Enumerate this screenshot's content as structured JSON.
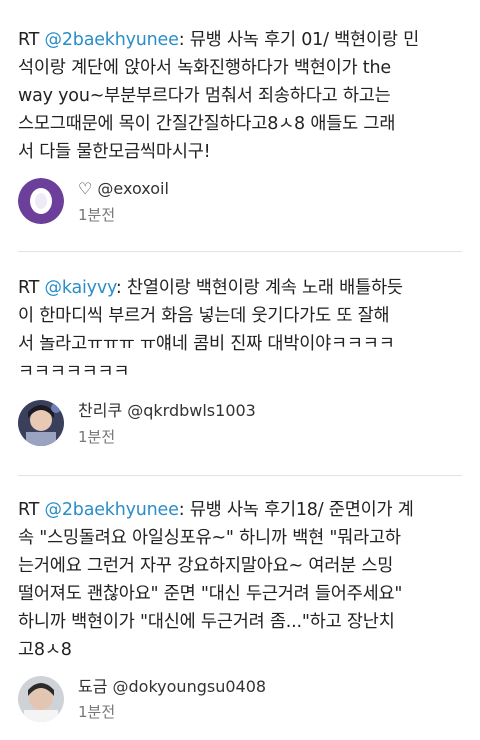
{
  "tweets": [
    {
      "rt": "RT ",
      "mention": "@2baekhyunee",
      "text": ": 뮤뱅 사녹 후기 01/ 백현이랑 민\n석이랑 계단에 앉아서 녹화진행하다가 백현이가 the\nway you~부분부르다가 멈춰서 죄송하다고 하고는\n스모그때문에 목이 간질간질하다고8ㅅ8 애들도 그래\n서 다들 물한모금씩마시구!",
      "author": "♡ @exoxoil",
      "time": "1분전",
      "avatar_color": "#6b3f9a"
    },
    {
      "rt": "RT ",
      "mention": "@kaiyvy",
      "text": ": 찬열이랑 백현이랑 계속 노래 배틀하듯\n이 한마디씩 부르거 화음 넣는데 웃기다가도 또 잘해\n서 놀라고ㅠㅠㅠ ㅠ얘네 콤비 진짜 대박이야ㅋㅋㅋㅋ\nㅋㅋㅋㅋㅋㅋㅋ",
      "author": "찬리쿠 @qkrdbwls1003",
      "time": "1분전",
      "avatar_color": "#2c3550"
    },
    {
      "rt": "RT ",
      "mention": "@2baekhyunee",
      "text": ": 뮤뱅 사녹 후기18/ 준면이가 계\n속 \"스밍돌려요 아일싱포유~\" 하니까 백현 \"뭐라고하\n는거에요 그런거 자꾸 강요하지말아요~ 여러분 스밍\n떨어져도 괜찮아요\" 준면 \"대신 두근거려 들어주세요\"\n하니까 백현이가 \"대신에 두근거려 좀...\"하고 장난치\n고8ㅅ8",
      "author": "됴금 @dokyoungsu0408",
      "time": "1분전",
      "avatar_color": "#cfd2d6"
    }
  ]
}
